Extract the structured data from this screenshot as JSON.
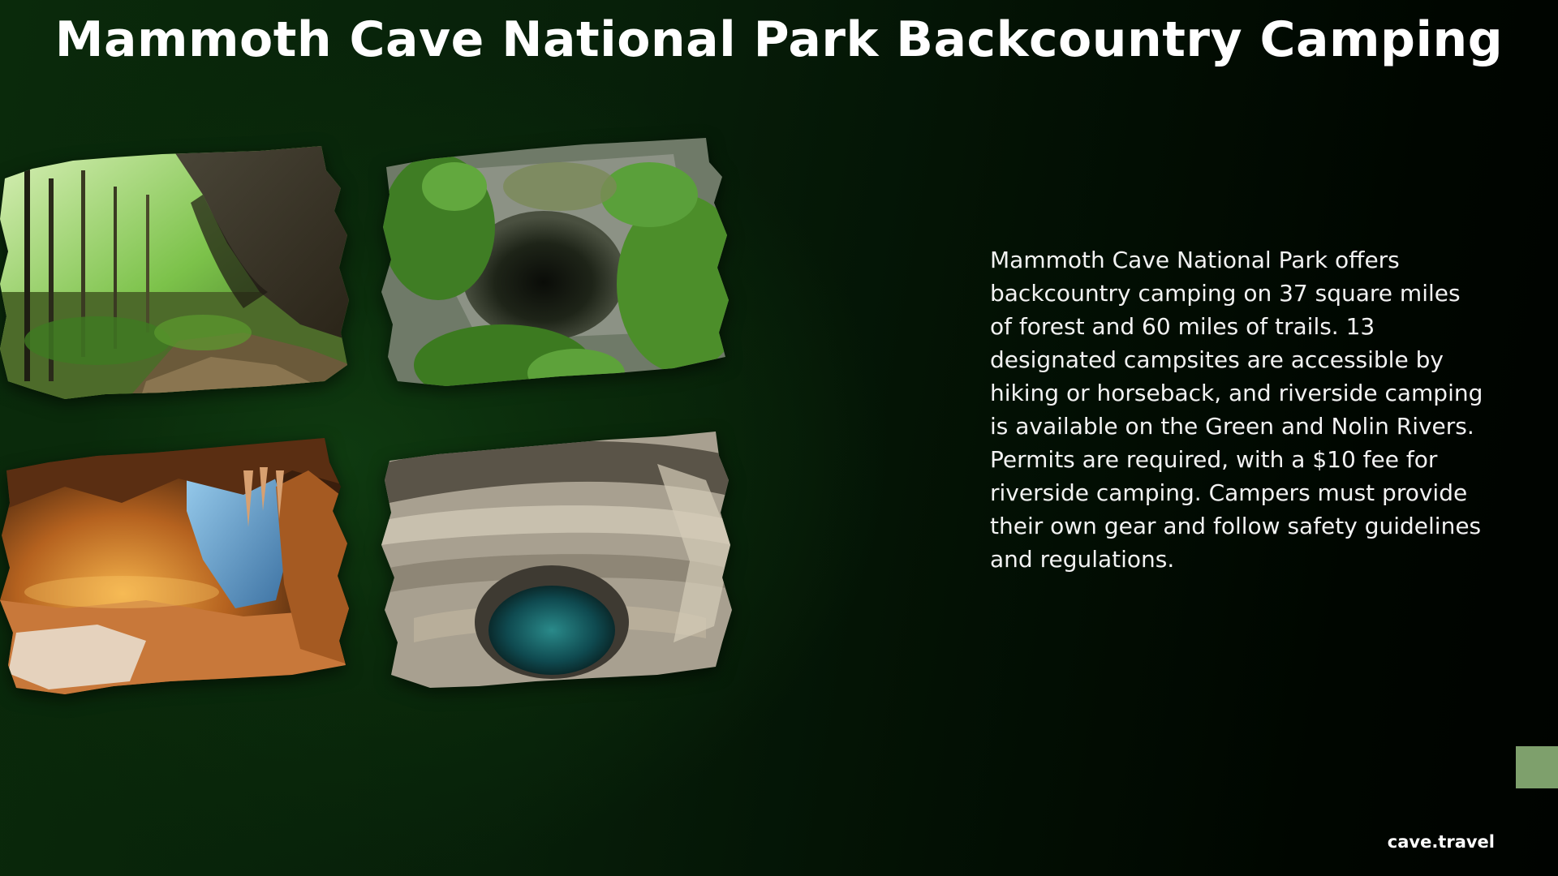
{
  "slide": {
    "title": "Mammoth Cave National Park Backcountry Camping",
    "body": "Mammoth Cave National Park offers backcountry camping on 37 square miles of forest and 60 miles of trails. 13 designated campsites are accessible by hiking or horseback, and riverside camping is available on the Green and Nolin Rivers. Permits are required, with a $10 fee for riverside camping. Campers must provide their own gear and follow safety guidelines and regulations.",
    "site": "cave.travel"
  },
  "photos": [
    {
      "name": "forest-cave-entrance-photo"
    },
    {
      "name": "sinkhole-forest-photo"
    },
    {
      "name": "lit-cave-interior-photo"
    },
    {
      "name": "limestone-pit-pool-photo"
    }
  ],
  "colors": {
    "background_dark": "#000300",
    "background_green": "#0a2a0b",
    "accent": "#7ea06c",
    "text": "#ffffff"
  }
}
